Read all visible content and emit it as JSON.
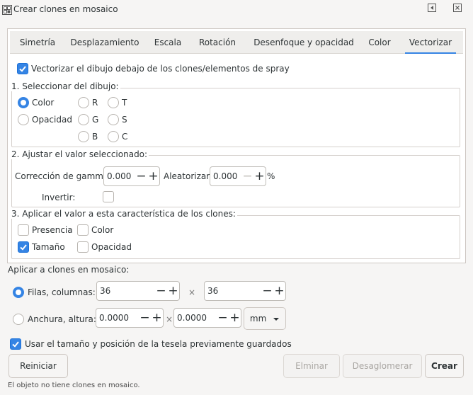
{
  "window": {
    "title": "Crear clones en mosaico"
  },
  "tabs": [
    "Simetría",
    "Desplazamiento",
    "Escala",
    "Rotación",
    "Desenfoque y opacidad",
    "Color",
    "Vectorizar"
  ],
  "active_tab": "Vectorizar",
  "vectorize_check": {
    "label": "Vectorizar el dibujo debajo de los clones/elementos de spray",
    "checked": true
  },
  "section1": {
    "title": "1. Seleccionar del dibujo:",
    "options": [
      "Color",
      "Opacidad",
      "R",
      "G",
      "B",
      "T",
      "S",
      "C"
    ],
    "selected": "Color"
  },
  "section2": {
    "title": "2. Ajustar el valor seleccionado:",
    "gamma_label": "Corrección de gamma:",
    "gamma_value": "0.000",
    "random_label": "Aleatorizar:",
    "random_value": "0.000",
    "percent": "%",
    "invert_label": "Invertir:",
    "invert_checked": false
  },
  "section3": {
    "title": "3. Aplicar el valor a esta característica de los clones:",
    "presence": {
      "label": "Presencia",
      "checked": false
    },
    "color": {
      "label": "Color",
      "checked": false
    },
    "size": {
      "label": "Tamaño",
      "checked": true
    },
    "opacity": {
      "label": "Opacidad",
      "checked": false
    }
  },
  "apply": {
    "title": "Aplicar a clones en mosaico:",
    "rows_cols_label": "Filas, columnas:",
    "rows_value": "36",
    "cols_value": "36",
    "times": "×",
    "width_height_label": "Anchura, altura:",
    "width_value": "0.0000",
    "height_value": "0.0000",
    "unit": "mm",
    "selected": "rows_cols"
  },
  "use_saved": {
    "label": "Usar el tamaño y posición de la tesela previamente guardados",
    "checked": true
  },
  "buttons": {
    "reset": "Reiniciar",
    "remove": "Elminar",
    "unclump": "Desaglomerar",
    "create": "Crear"
  },
  "status": "El objeto no tiene clones en mosaico.",
  "colors": {
    "accent": "#3584e4",
    "bg": "#f6f5f4"
  }
}
